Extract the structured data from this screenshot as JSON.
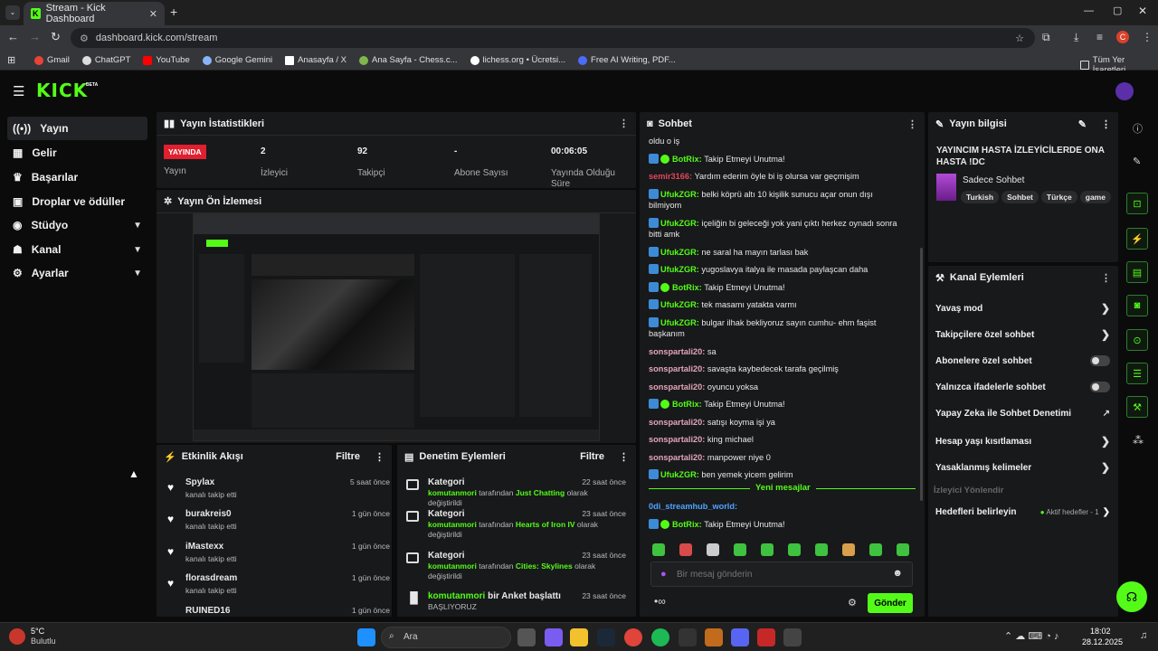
{
  "browser": {
    "tab_title": "Stream - Kick Dashboard",
    "url": "dashboard.kick.com/stream",
    "bookmarks": [
      "Gmail",
      "ChatGPT",
      "YouTube",
      "Google Gemini",
      "Anasayfa / X",
      "Ana Sayfa - Chess.c...",
      "lichess.org • Ücretsi...",
      "Free AI Writing, PDF..."
    ],
    "all_bookmarks": "Tüm Yer İşaretleri",
    "profile_initial": "C"
  },
  "brand": {
    "logo": "KICK",
    "beta": "BETA",
    "accent": "#53fc18"
  },
  "sidebar": {
    "items": [
      {
        "label": "Yayın"
      },
      {
        "label": "Gelir"
      },
      {
        "label": "Başarılar"
      },
      {
        "label": "Droplar ve ödüller"
      },
      {
        "label": "Stüdyo"
      },
      {
        "label": "Kanal"
      },
      {
        "label": "Ayarlar"
      }
    ]
  },
  "stats": {
    "title": "Yayın İstatistikleri",
    "live_badge": "YAYINDA",
    "items": [
      {
        "value": "",
        "label": "Yayın"
      },
      {
        "value": "2",
        "label": "İzleyici"
      },
      {
        "value": "92",
        "label": "Takipçi"
      },
      {
        "value": "-",
        "label": "Abone Sayısı"
      },
      {
        "value": "00:06:05",
        "label": "Yayında Olduğu Süre"
      }
    ]
  },
  "preview": {
    "title": "Yayın Ön İzlemesi"
  },
  "activity": {
    "title": "Etkinlik Akışı",
    "filter": "Filtre",
    "items": [
      {
        "name": "Spylax",
        "sub": "kanalı takip etti",
        "time": "5 saat önce"
      },
      {
        "name": "burakreis0",
        "sub": "kanalı takip etti",
        "time": "1 gün önce"
      },
      {
        "name": "iMastexx",
        "sub": "kanalı takip etti",
        "time": "1 gün önce"
      },
      {
        "name": "florasdream",
        "sub": "kanalı takip etti",
        "time": "1 gün önce"
      },
      {
        "name": "RUINED16",
        "sub": "",
        "time": "1 gün önce"
      }
    ]
  },
  "moderation": {
    "title": "Denetim Eylemleri",
    "filter": "Filtre",
    "items": [
      {
        "title": "Kategori",
        "time": "22 saat önce",
        "user": "komutanmori",
        "mid": "tarafından",
        "target": "Just Chatting",
        "end": "olarak değiştirildi"
      },
      {
        "title": "Kategori",
        "time": "23 saat önce",
        "user": "komutanmori",
        "mid": "tarafından",
        "target": "Hearts of Iron IV",
        "end": "olarak değiştirildi"
      },
      {
        "title": "Kategori",
        "time": "23 saat önce",
        "user": "komutanmori",
        "mid": "tarafından",
        "target": "Cities: Skylines",
        "end": "olarak değiştirildi"
      },
      {
        "title_user": "komutanmori",
        "title_rest": "bir Anket başlattı",
        "time": "23 saat önce",
        "sub": "BAŞLIYORUZ"
      }
    ]
  },
  "chat": {
    "title": "Sohbet",
    "messages": [
      {
        "user": "",
        "text": "oldu o iş",
        "color": "#e8e8e8"
      },
      {
        "user": "BotRix:",
        "text": "Takip Etmeyi Unutma!",
        "color": "#53fc18",
        "bot": true,
        "badge": true
      },
      {
        "user": "semir3166:",
        "text": "Yardım ederim öyle bi iş olursa var geçmişim",
        "color": "#e0475b"
      },
      {
        "user": "UfukZGR:",
        "text": "belki köprü altı 10 kişilik sunucu açar onun dışı bilmiyom",
        "color": "#53fc18",
        "bot": true
      },
      {
        "user": "UfukZGR:",
        "text": "içeliğin bi geleceği yok yani çıktı herkez oynadı sonra bitti amk",
        "color": "#53fc18",
        "bot": true
      },
      {
        "user": "UfukZGR:",
        "text": "ne saral ha mayın tarlası bak",
        "color": "#53fc18",
        "bot": true
      },
      {
        "user": "UfukZGR:",
        "text": "yugoslavya italya ile masada paylaşcan daha",
        "color": "#53fc18",
        "bot": true
      },
      {
        "user": "BotRix:",
        "text": "Takip Etmeyi Unutma!",
        "color": "#53fc18",
        "bot": true,
        "badge": true
      },
      {
        "user": "UfukZGR:",
        "text": "tek masamı yatakta varmı",
        "color": "#53fc18",
        "bot": true
      },
      {
        "user": "UfukZGR:",
        "text": "bulgar ilhak bekliyoruz sayın cumhu- ehm faşist başkanım",
        "color": "#53fc18",
        "bot": true
      },
      {
        "user": "sonspartali20:",
        "text": "sa",
        "color": "#e3a6b8"
      },
      {
        "user": "sonspartali20:",
        "text": "savaşta kaybedecek tarafa geçilmiş",
        "color": "#e3a6b8"
      },
      {
        "user": "sonspartali20:",
        "text": "oyuncu yoksa",
        "color": "#e3a6b8"
      },
      {
        "user": "BotRix:",
        "text": "Takip Etmeyi Unutma!",
        "color": "#53fc18",
        "bot": true,
        "badge": true
      },
      {
        "user": "sonspartali20:",
        "text": "satışı koyma işi ya",
        "color": "#e3a6b8"
      },
      {
        "user": "sonspartali20:",
        "text": "king michael",
        "color": "#e3a6b8"
      },
      {
        "user": "sonspartali20:",
        "text": "manpower niye 0",
        "color": "#e3a6b8"
      },
      {
        "user": "UfukZGR:",
        "text": "ben yemek yicem gelirim",
        "color": "#53fc18",
        "bot": true
      }
    ],
    "new_messages": "Yeni mesajlar",
    "after": [
      {
        "user": "0di_streamhub_world:",
        "text": "",
        "color": "#4ea3ff"
      },
      {
        "user": "BotRix:",
        "text": "Takip Etmeyi Unutma!",
        "color": "#53fc18",
        "bot": true,
        "badge": true
      }
    ],
    "placeholder": "Bir mesaj gönderin",
    "send": "Gönder"
  },
  "info": {
    "title": "Yayın bilgisi",
    "stream_title": "YAYINCIM HASTA İZLEYİCİLERDE ONA HASTA !DC",
    "category": "Sadece Sohbet",
    "tags": [
      "Turkish",
      "Sohbet",
      "Türkçe",
      "game"
    ]
  },
  "channel_actions": {
    "title": "Kanal Eylemleri",
    "items": [
      {
        "label": "Yavaş mod",
        "kind": "arrow"
      },
      {
        "label": "Takipçilere özel sohbet",
        "kind": "arrow"
      },
      {
        "label": "Abonelere özel sohbet",
        "kind": "toggle"
      },
      {
        "label": "Yalnızca ifadelerle sohbet",
        "kind": "toggle"
      },
      {
        "label": "Yapay Zeka ile Sohbet Denetimi",
        "kind": "link"
      },
      {
        "label": "Hesap yaşı kısıtlaması",
        "kind": "arrow"
      },
      {
        "label": "Yasaklanmış kelimeler",
        "kind": "arrow"
      }
    ],
    "section": "İzleyici Yönlendir",
    "goals_label": "Hedefleri belirleyin",
    "goals_status": "Aktif hedefler - 1"
  },
  "taskbar": {
    "weather_temp": "5°C",
    "weather_text": "Bulutlu",
    "search": "Ara",
    "time": "18:02",
    "date": "28.12.2025"
  }
}
